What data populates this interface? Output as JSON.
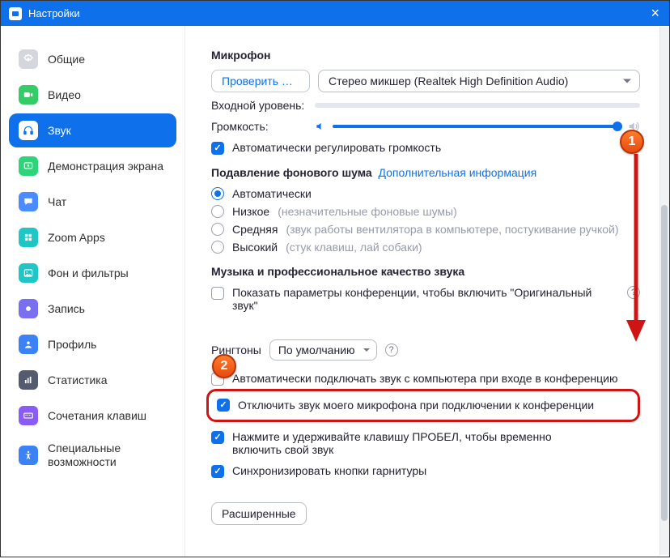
{
  "title": "Настройки",
  "sidebar": {
    "items": [
      {
        "label": "Общие"
      },
      {
        "label": "Видео"
      },
      {
        "label": "Звук"
      },
      {
        "label": "Демонстрация экрана"
      },
      {
        "label": "Чат"
      },
      {
        "label": "Zoom Apps"
      },
      {
        "label": "Фон и фильтры"
      },
      {
        "label": "Запись"
      },
      {
        "label": "Профиль"
      },
      {
        "label": "Статистика"
      },
      {
        "label": "Сочетания клавиш"
      },
      {
        "label": "Специальные возможности"
      }
    ],
    "active_index": 2
  },
  "main": {
    "mic_heading": "Микрофон",
    "test_button": "Проверить м…",
    "device_selected": "Стерео микшер (Realtek High Definition Audio)",
    "input_level_label": "Входной уровень:",
    "volume_label": "Громкость:",
    "auto_volume": {
      "checked": true,
      "label": "Автоматически регулировать громкость"
    },
    "noise_heading": "Подавление фонового шума",
    "noise_link": "Дополнительная информация",
    "noise_options": [
      {
        "label": "Автоматически",
        "hint": "",
        "selected": true
      },
      {
        "label": "Низкое",
        "hint": "(незначительные фоновые шумы)",
        "selected": false
      },
      {
        "label": "Средняя",
        "hint": "(звук работы вентилятора в компьютере, постукивание ручкой)",
        "selected": false
      },
      {
        "label": "Высокий",
        "hint": "(стук клавиш, лай собаки)",
        "selected": false
      }
    ],
    "music_heading": "Музыка и профессиональное качество звука",
    "original_sound": {
      "checked": false,
      "label": "Показать параметры конференции, чтобы включить \"Оригинальный звук\""
    },
    "ringtone_label": "Рингтоны",
    "ringtone_value": "По умолчанию",
    "checks": {
      "auto_join_audio": {
        "checked": false,
        "label": "Автоматически подключать звук с компьютера при входе в конференцию"
      },
      "mute_on_join": {
        "checked": true,
        "label": "Отключить звук моего микрофона при подключении к конференции"
      },
      "space_unmute": {
        "checked": true,
        "label": "Нажмите и удерживайте клавишу ПРОБЕЛ, чтобы временно включить свой звук"
      },
      "sync_headset": {
        "checked": true,
        "label": "Синхронизировать кнопки гарнитуры"
      }
    },
    "advanced_btn": "Расширенные"
  },
  "callouts": {
    "one": "1",
    "two": "2"
  }
}
